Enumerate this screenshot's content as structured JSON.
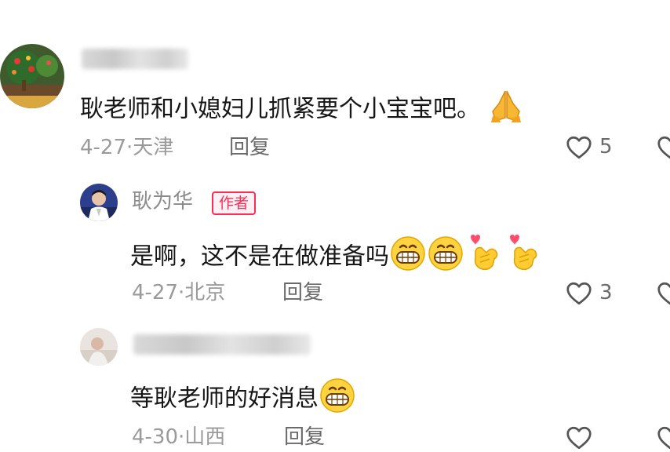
{
  "comments": [
    {
      "text": "耿老师和小媳妇儿抓紧要个小宝宝吧。",
      "emojis": [
        "folded-hands"
      ],
      "date": "4-27",
      "location": "天津",
      "reply_label": "回复",
      "likes": "5",
      "replies": [
        {
          "author": "耿为华",
          "badge": "作者",
          "text": "是啊，这不是在做准备吗",
          "emojis": [
            "grinning-face",
            "grinning-face",
            "finger-heart",
            "finger-heart"
          ],
          "date": "4-27",
          "location": "北京",
          "reply_label": "回复",
          "likes": "3"
        },
        {
          "text": "等耿老师的好消息",
          "emojis": [
            "grinning-face"
          ],
          "date": "4-30",
          "location": "山西",
          "reply_label": "回复"
        }
      ]
    }
  ],
  "colors": {
    "accent": "#fe2c55",
    "meta_text": "#9a9a9a",
    "body_text": "#161616"
  },
  "icons": [
    "heart-outline-icon",
    "folded-hands-emoji",
    "grinning-face-emoji",
    "finger-heart-emoji"
  ]
}
